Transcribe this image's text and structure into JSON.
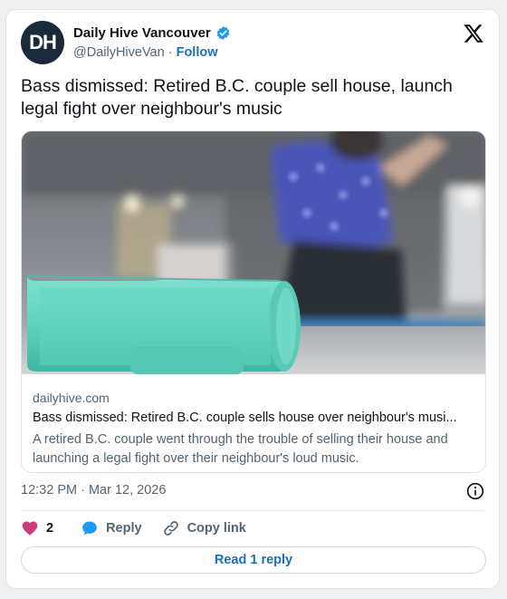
{
  "author": {
    "avatar_letters": "DH",
    "name": "Daily Hive Vancouver",
    "handle": "@DailyHiveVan",
    "separator": "·",
    "follow_label": "Follow"
  },
  "tweet": {
    "text": "Bass dismissed: Retired B.C. couple sell house, launch legal fight over neighbour's music"
  },
  "link_card": {
    "domain": "dailyhive.com",
    "title": "Bass dismissed: Retired B.C. couple sells house over neighbour's musi...",
    "description": "A retired B.C. couple went through the trouble of selling their house and launching a legal fight over their neighbour's loud music."
  },
  "timestamp": "12:32 PM · Mar 12, 2026",
  "actions": {
    "like_count": "2",
    "reply_label": "Reply",
    "copy_link_label": "Copy link"
  },
  "read_replies_label": "Read 1 reply",
  "colors": {
    "link_blue": "#1d6fb8",
    "like_pink": "#c93d79",
    "reply_blue": "#1d9bf0",
    "verified_blue": "#1d9bf0",
    "speaker_teal": "#5fd3c0"
  },
  "icons": [
    "verified-badge-icon",
    "x-logo-icon",
    "info-icon",
    "heart-icon",
    "reply-bubble-icon",
    "link-icon"
  ]
}
